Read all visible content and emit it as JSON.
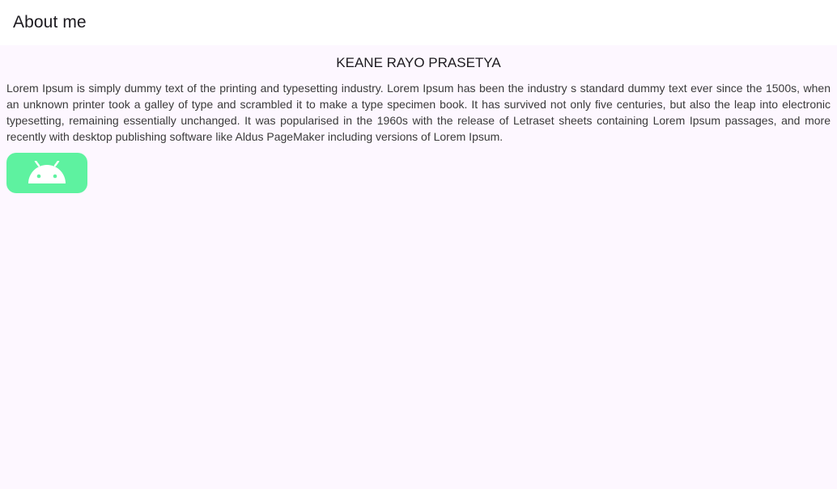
{
  "app_bar": {
    "title": "About me"
  },
  "profile": {
    "name": "KEANE RAYO PRASETYA",
    "about": "Lorem Ipsum is simply dummy text of the printing and typesetting industry. Lorem Ipsum has been the industry s standard dummy text ever since the 1500s, when an unknown printer took a galley of type and scrambled it to make a type specimen book. It has survived not only five centuries, but also the leap into electronic typesetting, remaining essentially unchanged. It was popularised in the 1960s with the release of Letraset sheets containing Lorem Ipsum passages, and more recently with desktop publishing software like Aldus PageMaker including versions of Lorem Ipsum."
  },
  "android_button": {
    "icon": "android-icon",
    "background": "#5ef2a0",
    "icon_color": "#ffffff"
  },
  "colors": {
    "background": "#fdf7ff",
    "app_bar": "#ffffff",
    "text": "#1d1b20"
  }
}
